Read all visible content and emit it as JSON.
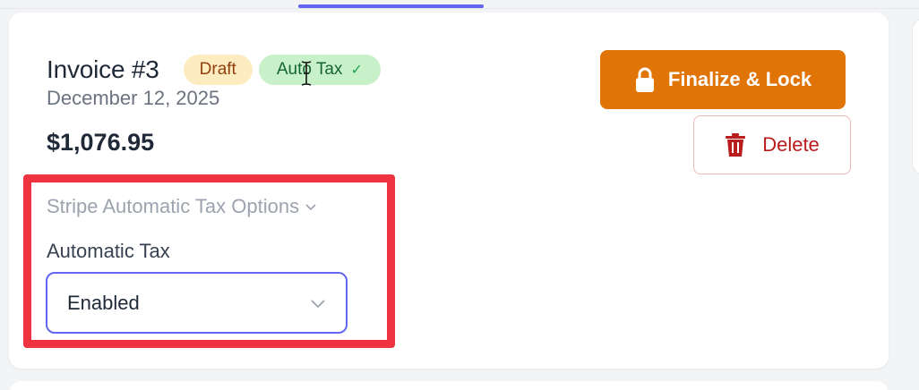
{
  "invoice": {
    "title": "Invoice #3",
    "badges": {
      "status": "Draft",
      "tax": "Auto Tax",
      "tax_check": "✓"
    },
    "date": "December 12, 2025",
    "amount": "$1,076.95"
  },
  "actions": {
    "finalize_label": "Finalize & Lock",
    "finalize_icon": "lock-icon",
    "delete_label": "Delete",
    "delete_icon": "trash-icon"
  },
  "tax_options": {
    "section_label": "Stripe Automatic Tax Options",
    "field_label": "Automatic Tax",
    "selected_value": "Enabled"
  },
  "colors": {
    "accent": "#6366f1",
    "finalize": "#e07406",
    "delete": "#b91c1c",
    "highlight": "#ef3340"
  }
}
